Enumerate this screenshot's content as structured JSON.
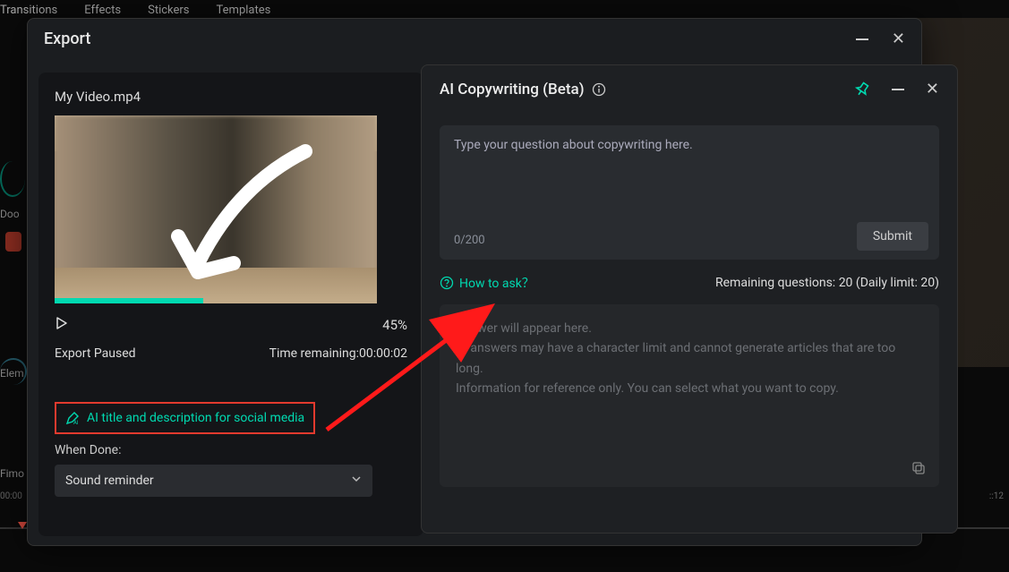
{
  "bg_tabs": {
    "t1": "Transitions",
    "t2": "Effects",
    "t3": "Stickers",
    "t4": "Templates"
  },
  "bg_side": {
    "s1": "Doo",
    "s2": "Elem",
    "s3": "Fimo"
  },
  "bg_timeline": {
    "t0": "00:00",
    "t1": "::12"
  },
  "export": {
    "title": "Export",
    "filename": "My Video.mp4",
    "percent": "45%",
    "status": "Export Paused",
    "time_label": "Time remaining:",
    "time_value": "00:00:02",
    "ai_link": "AI title and description for social media",
    "when_done_label": "When Done:",
    "dropdown_value": "Sound reminder"
  },
  "ai": {
    "title": "AI Copywriting (Beta)",
    "placeholder": "Type your question about copywriting here.",
    "counter": "0/200",
    "submit": "Submit",
    "how_to_ask": "How to ask？",
    "remaining_label": "Remaining questions:",
    "remaining_value": "20",
    "daily_label": "(Daily limit:",
    "daily_value": "20)",
    "answer_line1": "Answer will appear here.",
    "answer_line2": "AI answers may have a character limit and cannot generate articles that are too long.",
    "answer_line3": "Information for reference only. You can select what you want to copy."
  }
}
